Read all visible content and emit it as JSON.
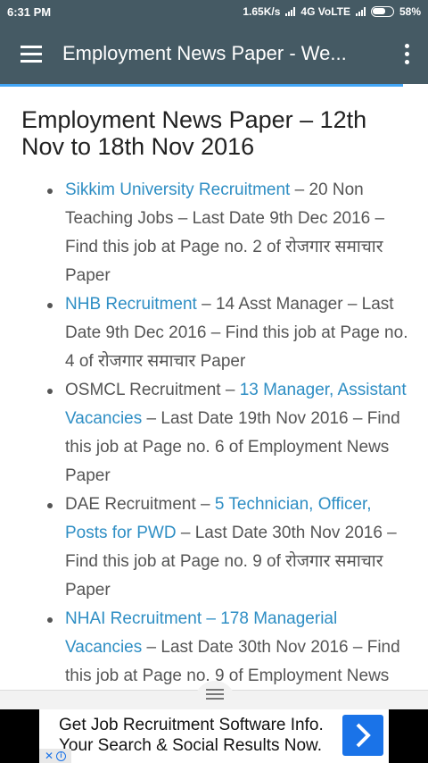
{
  "status_bar": {
    "time": "6:31 PM",
    "network_speed": "1.65K/s",
    "network_type": "4G VoLTE",
    "battery": "58%"
  },
  "app_bar": {
    "title": "Employment News Paper - We...",
    "menu_icon": "hamburger-menu-icon",
    "overflow_icon": "more-vert-icon"
  },
  "article": {
    "heading": "Employment News Paper – 12th Nov to 18th Nov 2016",
    "jobs": [
      {
        "pre": "",
        "link": "Sikkim University Recruitment",
        "post": " – 20 Non Teaching Jobs – Last Date 9th Dec 2016 – Find this job at Page no. 2 of रोजगार समाचार Paper"
      },
      {
        "pre": "",
        "link": "NHB Recruitment",
        "post": " – 14 Asst Manager – Last Date 9th Dec 2016 – Find this job at Page no. 4 of रोजगार समाचार Paper"
      },
      {
        "pre": "OSMCL Recruitment – ",
        "link": "13 Manager, Assistant Vacancies",
        "post": " – Last Date 19th Nov 2016 – Find this job at Page no. 6 of Employment News Paper"
      },
      {
        "pre": "DAE Recruitment – ",
        "link": "5 Technician, Officer, Posts for PWD",
        "post": " – Last Date 30th Nov 2016 – Find this job at Page no. 9 of रोजगार समाचार Paper"
      },
      {
        "pre": "",
        "link": "NHAI Recruitment",
        "post": " – ",
        "link2": "178 Managerial Vacancies",
        "post2": " – Last Date 30th Nov 2016 – Find this job at Page no. 9 of Employment News"
      }
    ]
  },
  "ad": {
    "text": "Get Job Recruitment Software Info. Your Search & Social Results Now.",
    "arrow_icon": "chevron-right-icon",
    "choices_icon": "ad-choices-icon"
  },
  "colors": {
    "toolbar": "#455a64",
    "link": "#2e8ec4",
    "progress": "#42a5f5",
    "ad_button": "#1a73e8"
  }
}
